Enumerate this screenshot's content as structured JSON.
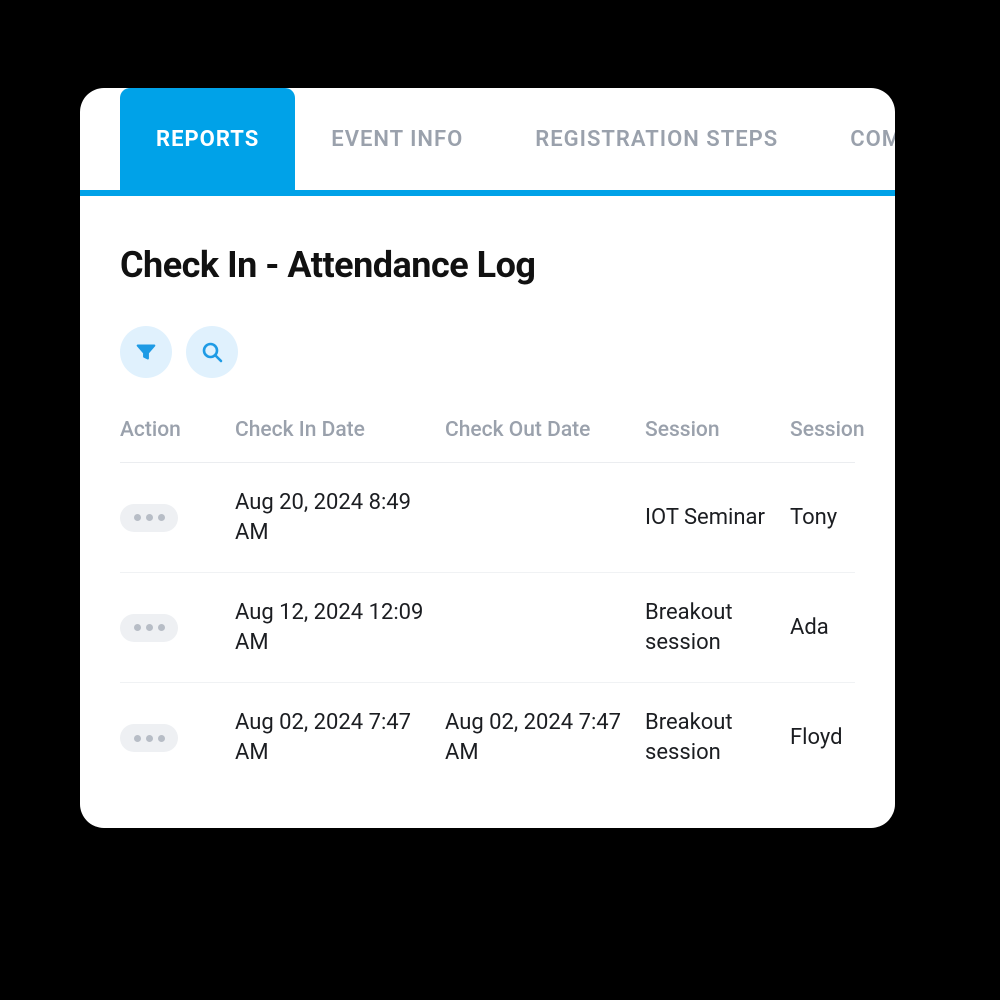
{
  "tabs": [
    {
      "label": "REPORTS",
      "active": true
    },
    {
      "label": "EVENT INFO",
      "active": false
    },
    {
      "label": "REGISTRATION STEPS",
      "active": false
    },
    {
      "label": "COMMUNICATIONS",
      "active": false
    }
  ],
  "page_title": "Check In - Attendance Log",
  "columns": {
    "action": "Action",
    "check_in": "Check In Date",
    "check_out": "Check Out Date",
    "session": "Session",
    "name": "Session"
  },
  "rows": [
    {
      "check_in": "Aug 20, 2024 8:49 AM",
      "check_out": "",
      "session": "IOT Seminar",
      "name": "Tony"
    },
    {
      "check_in": "Aug 12, 2024 12:09 AM",
      "check_out": "",
      "session": "Breakout session",
      "name": "Ada"
    },
    {
      "check_in": "Aug 02, 2024 7:47 AM",
      "check_out": "Aug 02, 2024 7:47 AM",
      "session": "Breakout session",
      "name": "Floyd"
    }
  ]
}
